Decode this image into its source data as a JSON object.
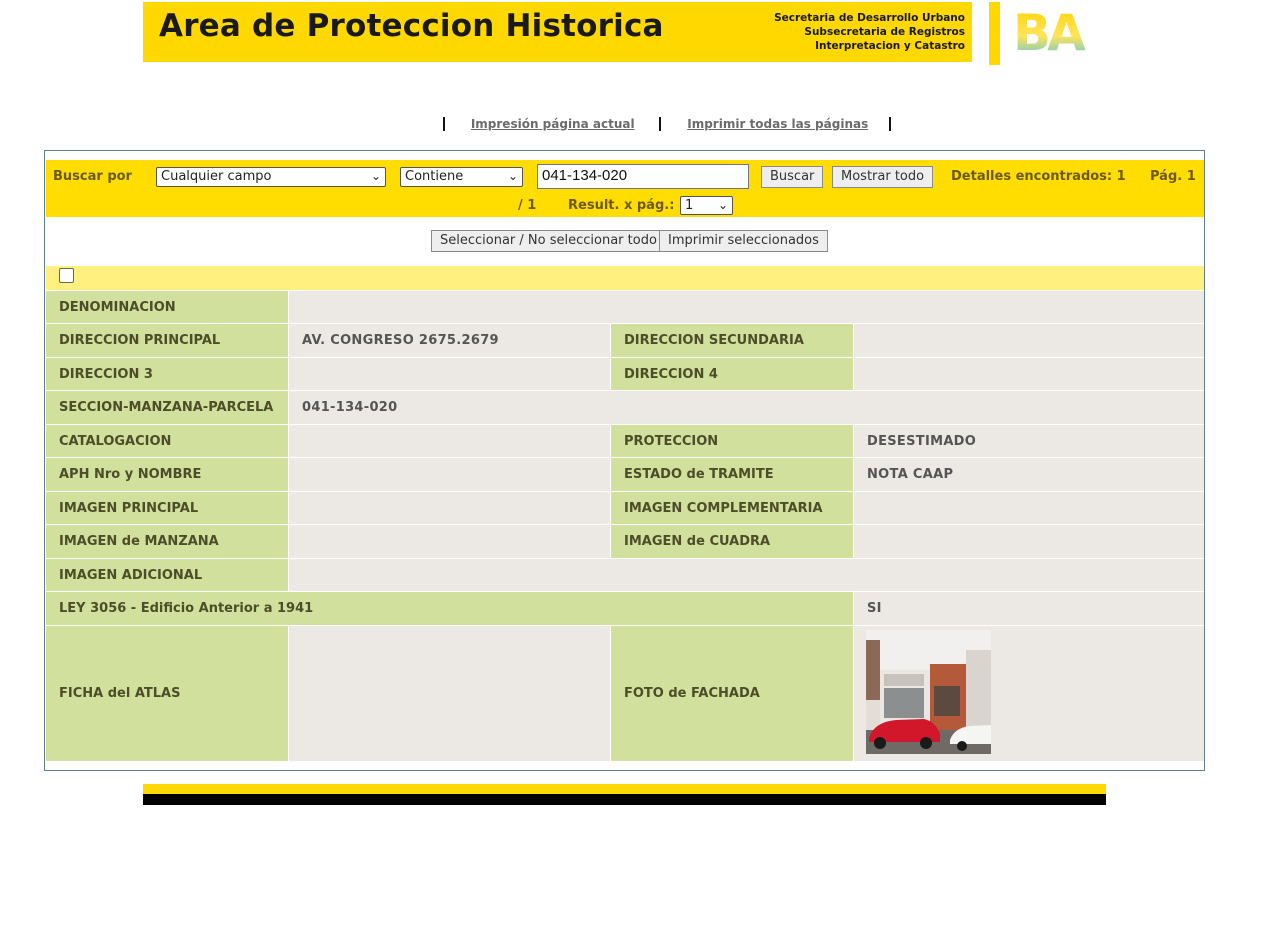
{
  "header": {
    "title": "Area de Proteccion Historica",
    "subtitle_lines": [
      "Secretaria de Desarrollo Urbano",
      "Subsecretaria de Registros",
      "Interpretacion y Catastro"
    ],
    "logo_text": "BA",
    "brand_color": "#ffd800"
  },
  "print_links": {
    "current_page": "Impresión página actual",
    "all_pages": "Imprimir todas las páginas"
  },
  "search": {
    "label": "Buscar por",
    "field_select": "Cualquier campo",
    "operator_select": "Contiene",
    "query_value": "041-134-020",
    "search_button": "Buscar",
    "show_all_button": "Mostrar todo",
    "found_label": "Detalles encontrados: 1",
    "page_label": "Pág. 1",
    "page_total": "/ 1",
    "per_page_label": "Result. x pág.:",
    "per_page_select": "1"
  },
  "actions": {
    "toggle_select_all": "Seleccionar / No seleccionar todo",
    "print_selected": "Imprimir seleccionados"
  },
  "record": {
    "denominacion": {
      "label": "DENOMINACION",
      "value": ""
    },
    "direccion_principal": {
      "label": "DIRECCION PRINCIPAL",
      "value": "AV. CONGRESO 2675.2679"
    },
    "direccion_secundaria": {
      "label": "DIRECCION SECUNDARIA",
      "value": ""
    },
    "direccion_3": {
      "label": "DIRECCION 3",
      "value": ""
    },
    "direccion_4": {
      "label": "DIRECCION 4",
      "value": ""
    },
    "smp": {
      "label": "SECCION-MANZANA-PARCELA",
      "value": "041-134-020"
    },
    "catalogacion": {
      "label": "CATALOGACION",
      "value": ""
    },
    "proteccion": {
      "label": "PROTECCION",
      "value": "DESESTIMADO"
    },
    "aph": {
      "label": "APH Nro y NOMBRE",
      "value": ""
    },
    "estado_tramite": {
      "label": "ESTADO de TRAMITE",
      "value": "NOTA CAAP"
    },
    "imagen_principal": {
      "label": "IMAGEN PRINCIPAL",
      "value": ""
    },
    "imagen_complementaria": {
      "label": "IMAGEN COMPLEMENTARIA",
      "value": ""
    },
    "imagen_manzana": {
      "label": "IMAGEN de MANZANA",
      "value": ""
    },
    "imagen_cuadra": {
      "label": "IMAGEN de CUADRA",
      "value": ""
    },
    "imagen_adicional": {
      "label": "IMAGEN ADICIONAL",
      "value": ""
    },
    "ley_3056": {
      "label": "LEY 3056 - Edificio Anterior a 1941",
      "value": "SI"
    },
    "ficha_atlas": {
      "label": "FICHA del ATLAS",
      "value": ""
    },
    "foto_fachada": {
      "label": "FOTO de FACHADA"
    }
  }
}
